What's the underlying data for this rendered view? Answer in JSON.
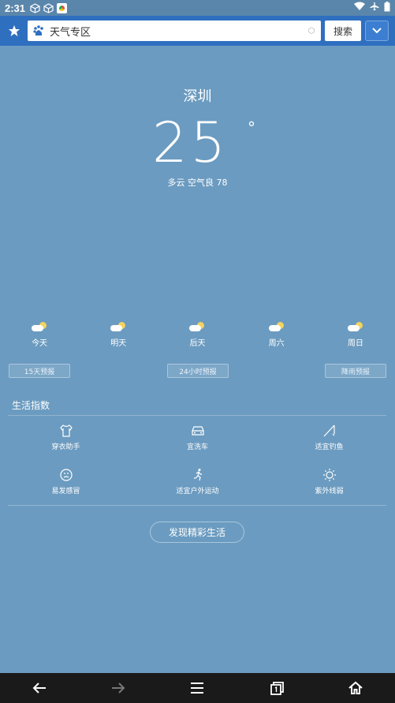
{
  "status_bar": {
    "time": "2:31"
  },
  "toolbar": {
    "address_text": "天气专区",
    "search_label": "搜索"
  },
  "weather": {
    "city": "深圳",
    "temperature": "25",
    "degree_symbol": "°",
    "condition": "多云  空气良 78",
    "forecast": [
      {
        "label": "今天",
        "icon": "partly-cloudy-icon"
      },
      {
        "label": "明天",
        "icon": "partly-cloudy-icon"
      },
      {
        "label": "后天",
        "icon": "partly-cloudy-icon"
      },
      {
        "label": "周六",
        "icon": "partly-cloudy-icon"
      },
      {
        "label": "周日",
        "icon": "partly-cloudy-icon"
      }
    ],
    "pills": [
      "15天预报",
      "24小时预报",
      "降雨预报"
    ]
  },
  "life": {
    "title": "生活指数",
    "items": [
      {
        "label": "穿衣助手",
        "icon": "shirt-icon"
      },
      {
        "label": "宜洗车",
        "icon": "car-icon"
      },
      {
        "label": "适宜钓鱼",
        "icon": "fishing-rod-icon"
      },
      {
        "label": "易发感冒",
        "icon": "sad-face-icon"
      },
      {
        "label": "适宜户外运动",
        "icon": "runner-icon"
      },
      {
        "label": "紫外线弱",
        "icon": "sun-icon"
      }
    ],
    "discover_label": "发现精彩生活"
  },
  "colors": {
    "background": "#6b9bc0",
    "toolbar": "#2f6fc0",
    "nav": "#1a1a1a"
  }
}
